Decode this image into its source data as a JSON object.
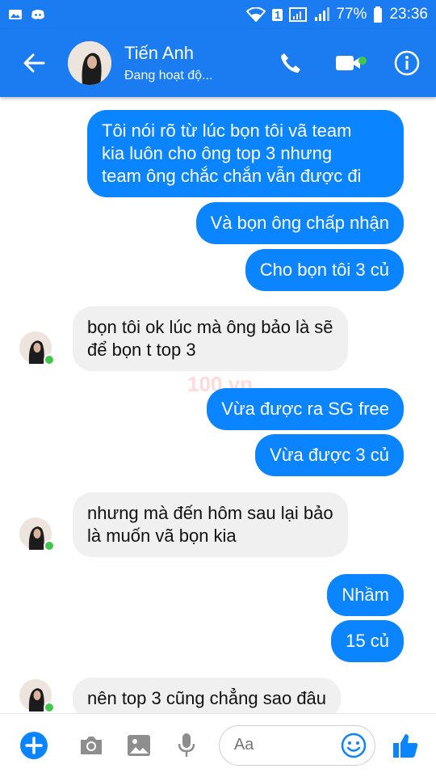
{
  "status": {
    "battery": "77%",
    "time": "23:36",
    "sim": "1"
  },
  "header": {
    "contact_name": "Tiến Anh",
    "status_text": "Đang hoạt độ..."
  },
  "messages": [
    {
      "dir": "out",
      "text": "Tôi nói rõ từ lúc bọn tôi vã team\nkia luôn cho ông top 3 nhưng\nteam ông chắc chắn vẫn được đi"
    },
    {
      "dir": "out",
      "text": "Và bọn ông chấp nhận"
    },
    {
      "dir": "out",
      "text": "Cho bọn tôi 3 củ"
    },
    {
      "dir": "in",
      "text": "bọn tôi ok lúc mà ông bảo là sẽ\nđể bọn t top 3"
    },
    {
      "dir": "out",
      "text": "Vừa được ra SG free"
    },
    {
      "dir": "out",
      "text": "Vừa được 3 củ"
    },
    {
      "dir": "in",
      "text": "nhưng mà đến hôm sau lại bảo\nlà muốn vã bọn kia"
    },
    {
      "dir": "out",
      "text": "Nhầm"
    },
    {
      "dir": "out",
      "text": "15 củ"
    },
    {
      "dir": "in",
      "text": "nên top 3 cũng chẳng sao đâu"
    }
  ],
  "watermark": "100.vn",
  "composer": {
    "placeholder": "Aa"
  },
  "colors": {
    "brand": "#1a7cf0",
    "bubble_out": "#0b84ff",
    "bubble_in": "#f1f0f0",
    "online": "#43c74a"
  }
}
